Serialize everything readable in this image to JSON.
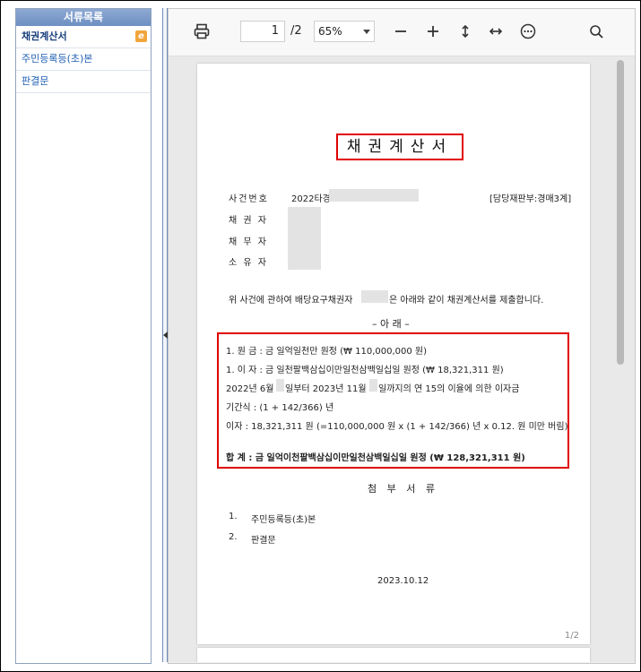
{
  "sidebar": {
    "title": "서류목록",
    "items": [
      {
        "label": "채권계산서",
        "badge": "e"
      },
      {
        "label": "주민등록등(초)본"
      },
      {
        "label": "판결문"
      }
    ]
  },
  "toolbar": {
    "current_page": "1",
    "total_pages": "/2",
    "zoom": "65%",
    "icons": [
      "print-icon",
      "zoom-out-icon",
      "zoom-in-icon",
      "fit-height-icon",
      "fit-width-icon",
      "more-icon",
      "search-icon"
    ]
  },
  "document": {
    "title": "채권계산서",
    "case_label": "사건번호",
    "case_number": "2022타경",
    "court_dept": "[담당재판부:경매3계]",
    "creditor_label": "채 권 자",
    "debtor_label": "채 무 자",
    "owner_label": "소 유 자",
    "intro_text_a": "위 사건에 관하여 배당요구채권자",
    "intro_text_b": "은 아래와 같이 채권계산서를 제출합니다.",
    "below_heading": "– 아    래 –",
    "lines": [
      "1. 원    금 : 금  일억일천만  원정  (₩  110,000,000 원)",
      "1. 이    자 : 금  일천팔백삼십이만일천삼백일십일  원정  (₩  18,321,311 원)",
      "2022년 6월",
      "일부터 2023년 11월",
      "일까지의 연 15의 이율에 의한 이자금",
      "기간식 : (1 + 142/366) 년",
      "이자 : 18,321,311 원 (=110,000,000 원 x (1 + 142/366) 년 x 0.12. 원 미만 버림)"
    ],
    "total_line": "합    계 : 금  일억이천팔백삼십이만일천삼백일십일  원정  (₩  128,321,311 원)",
    "attachments_heading": "첨 부 서 류",
    "attachments": [
      {
        "num": "1.",
        "label": "주민등록등(초)본"
      },
      {
        "num": "2.",
        "label": "판결문"
      }
    ],
    "date": "2023.10.12",
    "page_number": "1/2"
  },
  "colors": {
    "highlight_border": "#e00000",
    "sidebar_header": "#7a98c8",
    "link_text": "#1f5fb3"
  }
}
